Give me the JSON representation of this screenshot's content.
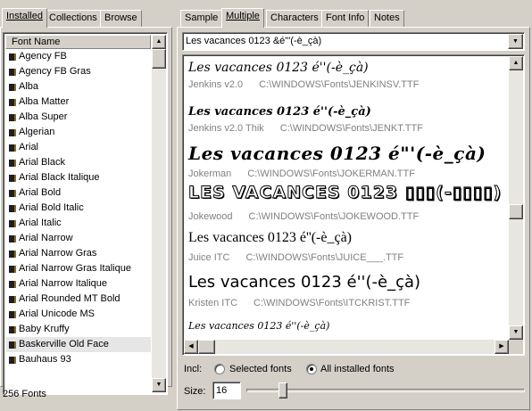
{
  "left_tabs": [
    {
      "label": "Installed",
      "active": true
    },
    {
      "label": "Collections",
      "active": false
    },
    {
      "label": "Browse",
      "active": false
    }
  ],
  "font_list": {
    "header": "Font Name",
    "items": [
      "Agency FB",
      "Agency FB Gras",
      "Alba",
      "Alba Matter",
      "Alba Super",
      "Algerian",
      "Arial",
      "Arial Black",
      "Arial Black Italique",
      "Arial Bold",
      "Arial Bold Italic",
      "Arial Italic",
      "Arial Narrow",
      "Arial Narrow Gras",
      "Arial Narrow Gras Italique",
      "Arial Narrow Italique",
      "Arial Rounded MT Bold",
      "Arial Unicode MS",
      "Baby Kruffy",
      "Baskerville Old Face",
      "Bauhaus 93"
    ],
    "selected": "Baskerville Old Face",
    "status": "256 Fonts"
  },
  "right_tabs": [
    {
      "label": "Sample",
      "active": false
    },
    {
      "label": "Multiple",
      "active": true
    },
    {
      "label": "Characters",
      "active": false
    },
    {
      "label": "Font Info",
      "active": false
    },
    {
      "label": "Notes",
      "active": false
    }
  ],
  "sample_text": "Les vacances  0123 &é\"'(-è_çà)",
  "previews": [
    {
      "sample": "Les vacances  0123 é''(-è_çà)",
      "name": "Jenkins v2.0",
      "path": "C:\\WINDOWS\\Fonts\\JENKINSV.TTF"
    },
    {
      "sample": "Les vacances  0123 é''(-è_çà)",
      "name": "Jenkins v2.0  Thik",
      "path": "C:\\WINDOWS\\Fonts\\JENKT.TTF"
    },
    {
      "sample": "Les vacances  0123 é\"'(-è_çà)",
      "name": "Jokerman",
      "path": "C:\\WINDOWS\\Fonts\\JOKERMAN.TTF"
    },
    {
      "sample": "LES VACANCES  0123 ▯▯▯(-▯▯▯▯)",
      "name": "Jokewood",
      "path": "C:\\WINDOWS\\Fonts\\JOKEWOOD.TTF"
    },
    {
      "sample": "Les vacances  0123 é''(-è_çà)",
      "name": "Juice ITC",
      "path": "C:\\WINDOWS\\Fonts\\JUICE___.TTF"
    },
    {
      "sample": "Les vacances  0123 é''(-è_çà)",
      "name": "Kristen ITC",
      "path": "C:\\WINDOWS\\Fonts\\ITCKRIST.TTF"
    },
    {
      "sample": "Les vacances  0123 é''(-è_çà)",
      "name": "",
      "path": ""
    }
  ],
  "include": {
    "label": "Incl:",
    "options": [
      {
        "label": "Selected fonts",
        "checked": false
      },
      {
        "label": "All installed fonts",
        "checked": true
      }
    ]
  },
  "size": {
    "label": "Size:",
    "value": "16"
  },
  "size_slider_fraction": 0.12
}
